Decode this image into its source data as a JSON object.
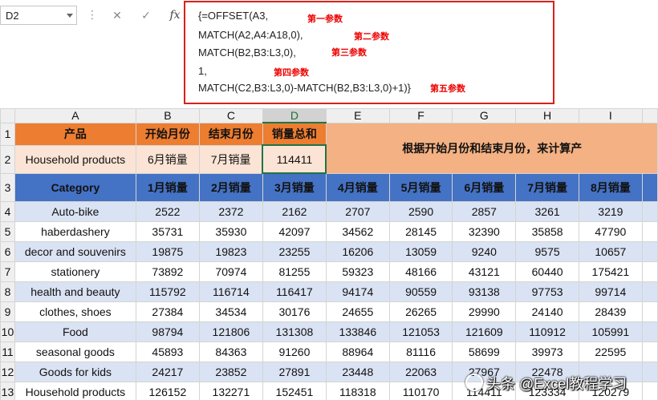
{
  "namebox": "D2",
  "formula_bar": {
    "cancel_icon": "x-icon",
    "enter_icon": "check-icon",
    "fx_label": "fx",
    "lines": [
      "{=OFFSET(A3,",
      "MATCH(A2,A4:A18,0),",
      "MATCH(B2,B3:L3,0),",
      "1,",
      "MATCH(C2,B3:L3,0)-MATCH(B2,B3:L3,0)+1)}"
    ],
    "notes": [
      "第一参数",
      "第二参数",
      "第三参数",
      "第四参数",
      "第五参数"
    ],
    "note_color": "#e00000"
  },
  "columns": [
    "A",
    "B",
    "C",
    "D",
    "E",
    "F",
    "G",
    "H",
    "I"
  ],
  "selected_column": "D",
  "row_numbers": [
    "1",
    "2",
    "3",
    "4",
    "5",
    "6",
    "7",
    "8",
    "9",
    "10",
    "11",
    "12",
    "13"
  ],
  "header_row1": [
    "产品",
    "开始月份",
    "结束月份",
    "销量总和"
  ],
  "row2": [
    "Household products",
    "6月销量",
    "7月销量",
    "114411"
  ],
  "banner": "根据开始月份和结束月份，来计算产",
  "table_header": [
    "Category",
    "1月销量",
    "2月销量",
    "3月销量",
    "4月销量",
    "5月销量",
    "6月销量",
    "7月销量",
    "8月销量"
  ],
  "rows": [
    [
      "Auto-bike",
      "2522",
      "2372",
      "2162",
      "2707",
      "2590",
      "2857",
      "3261",
      "3219"
    ],
    [
      "haberdashery",
      "35731",
      "35930",
      "42097",
      "34562",
      "28145",
      "32390",
      "35858",
      "47790"
    ],
    [
      "decor and souvenirs",
      "19875",
      "19823",
      "23255",
      "16206",
      "13059",
      "9240",
      "9575",
      "10657"
    ],
    [
      "stationery",
      "73892",
      "70974",
      "81255",
      "59323",
      "48166",
      "43121",
      "60440",
      "175421"
    ],
    [
      "health and beauty",
      "115792",
      "116714",
      "116417",
      "94174",
      "90559",
      "93138",
      "97753",
      "99714"
    ],
    [
      "clothes, shoes",
      "27384",
      "34534",
      "30176",
      "24655",
      "26265",
      "29990",
      "24140",
      "28439"
    ],
    [
      "Food",
      "98794",
      "121806",
      "131308",
      "133846",
      "121053",
      "121609",
      "110912",
      "105991"
    ],
    [
      "seasonal goods",
      "45893",
      "84363",
      "91260",
      "88964",
      "81116",
      "58699",
      "39973",
      "22595"
    ],
    [
      "Goods for kids",
      "24217",
      "23852",
      "27891",
      "23448",
      "22063",
      "27967",
      "22478",
      ""
    ],
    [
      "Household products",
      "126152",
      "132271",
      "152451",
      "118318",
      "110170",
      "114411",
      "123334",
      "120279"
    ]
  ],
  "colors": {
    "orange": "#ed7d31",
    "peach": "#fbe4d5",
    "banner_bg": "#f4b183",
    "banner_text": "#2f5597",
    "blue_header": "#4472c4",
    "band": "#dae3f3",
    "select_green": "#217346"
  },
  "watermark": "头条 @Excel教程学习"
}
